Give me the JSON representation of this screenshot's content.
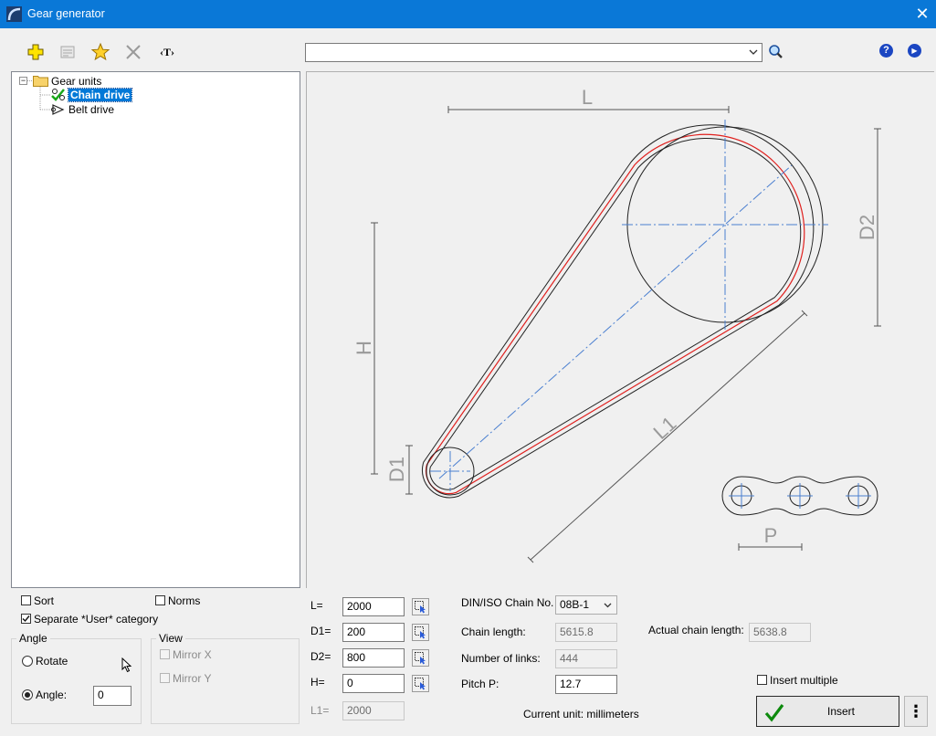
{
  "window": {
    "title": "Gear generator",
    "close_glyph": "✕"
  },
  "toolbar": {
    "icons": [
      "add-icon",
      "properties-icon",
      "favorite-star-icon",
      "delete-icon",
      "text-icon"
    ],
    "text_icon_glyph": "‹T›"
  },
  "search": {
    "value": ""
  },
  "help": {
    "help_icon_glyph": "?",
    "next_icon_glyph": "▶"
  },
  "tree": {
    "root_label": "Gear units",
    "expander_glyph": "−",
    "items": [
      {
        "label": "Chain drive",
        "selected": true
      },
      {
        "label": "Belt drive",
        "selected": false
      }
    ]
  },
  "drawing": {
    "label_L": "L",
    "label_D1": "D1",
    "label_D2": "D2",
    "label_H": "H",
    "label_L1": "L1",
    "label_P": "P"
  },
  "options": {
    "sort_label": "Sort",
    "sort_checked": false,
    "norms_label": "Norms",
    "norms_checked": false,
    "separate_label": "Separate *User* category",
    "separate_checked": true
  },
  "angle_group": {
    "title": "Angle",
    "rotate_label": "Rotate",
    "angle_label": "Angle:",
    "angle_value": "0",
    "selected": "angle"
  },
  "view_group": {
    "title": "View",
    "mirror_x_label": "Mirror X",
    "mirror_y_label": "Mirror Y"
  },
  "params": [
    {
      "label": "L=",
      "value": "2000",
      "has_picker": true,
      "readonly": false
    },
    {
      "label": "D1=",
      "value": "200",
      "has_picker": true,
      "readonly": false
    },
    {
      "label": "D2=",
      "value": "800",
      "has_picker": true,
      "readonly": false
    },
    {
      "label": "H=",
      "value": "0",
      "has_picker": true,
      "readonly": false
    },
    {
      "label": "L1=",
      "value": "2000",
      "has_picker": false,
      "readonly": true
    }
  ],
  "chain": {
    "chain_no_label": "DIN/ISO Chain No.",
    "chain_no_value": "08B-1",
    "chain_length_label": "Chain length:",
    "chain_length_value": "5615.8",
    "links_label": "Number of links:",
    "links_value": "444",
    "pitch_label": "Pitch P:",
    "pitch_value": "12.7",
    "actual_label": "Actual chain length:",
    "actual_value": "5638.8",
    "unit_text": "Current unit: millimeters"
  },
  "insert": {
    "multiple_label": "Insert multiple",
    "multiple_checked": false,
    "button_label": "Insert",
    "more_glyph": "⋮"
  },
  "colors": {
    "title_bar": "#0a78d7",
    "selection": "#0078d7",
    "chain_red": "#e0201e",
    "center_lines": "#4a7fd0"
  }
}
